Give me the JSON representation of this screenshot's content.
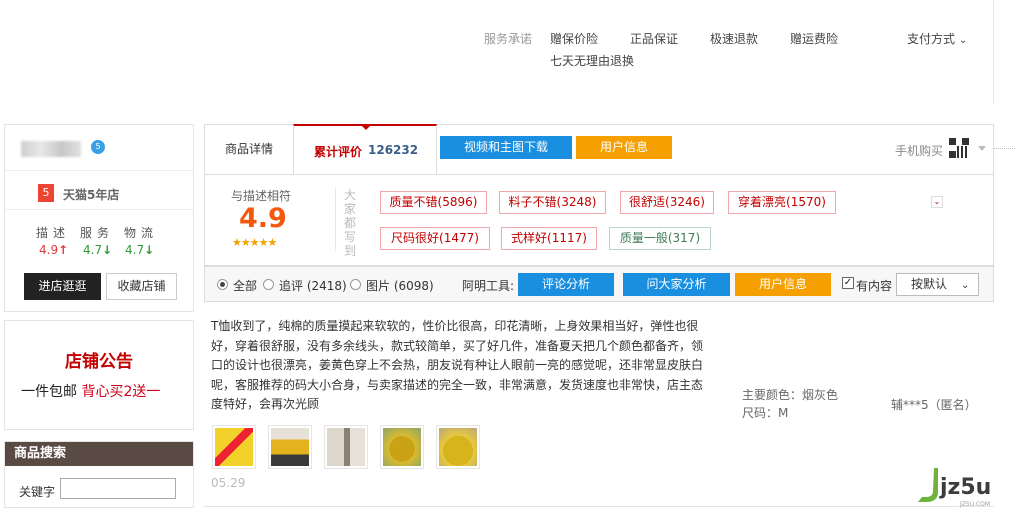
{
  "service_bar": {
    "label": "服务承诺",
    "items": [
      "赠保价险",
      "正品保证",
      "极速退款",
      "赠运费险"
    ],
    "second_line": "七天无理由退换",
    "payment": "支付方式"
  },
  "shop_card": {
    "badge": "5",
    "rank_number": "5",
    "rank_text": "天猫5年店",
    "headers": [
      "描述",
      "服务",
      "物流"
    ],
    "scores": [
      {
        "value": "4.9",
        "trend": "↑",
        "color": "#e4393c"
      },
      {
        "value": "4.7",
        "trend": "↓",
        "color": "#2e9c35"
      },
      {
        "value": "4.7",
        "trend": "↓",
        "color": "#2e9c35"
      }
    ],
    "enter_shop": "进店逛逛",
    "favorite_shop": "收藏店铺"
  },
  "notice": {
    "title": "店铺公告",
    "line_prefix": "一件包邮 ",
    "line_highlight": "背心买2送一"
  },
  "search": {
    "title": "商品搜索",
    "keyword_label": "关键字",
    "keyword_value": ""
  },
  "tabs": {
    "detail": "商品详情",
    "reviews_label": "累计评价",
    "reviews_count": "126232",
    "video_download": "视频和主图下载",
    "user_info": "用户信息",
    "mobile_buy": "手机购买"
  },
  "summary": {
    "label": "与描述相符",
    "score": "4.9",
    "stars": "★★★★★",
    "side_text": "大家都写到",
    "tags": [
      {
        "text": "质量不错(5896)",
        "type": "positive"
      },
      {
        "text": "料子不错(3248)",
        "type": "positive"
      },
      {
        "text": "很舒适(3246)",
        "type": "positive"
      },
      {
        "text": "穿着漂亮(1570)",
        "type": "positive"
      },
      {
        "text": "尺码很好(1477)",
        "type": "positive"
      },
      {
        "text": "式样好(1117)",
        "type": "positive"
      },
      {
        "text": "质量一般(317)",
        "type": "neutral"
      }
    ]
  },
  "filter": {
    "options": [
      {
        "label": "全部",
        "selected": true
      },
      {
        "label": "追评 (2418)",
        "selected": false
      },
      {
        "label": "图片 (6098)",
        "selected": false
      }
    ],
    "tools_label": "阿明工具:",
    "tool_buttons": [
      "评论分析",
      "问大家分析",
      "用户信息"
    ],
    "has_content": "有内容",
    "has_content_checked": true,
    "sort": "按默认"
  },
  "review": {
    "text": "T恤收到了，纯棉的质量摸起来软软的，性价比很高，印花清晰，上身效果相当好，弹性也很好，穿着很舒服，没有多余线头，款式较简单，买了好几件，准备夏天把几个颜色都备齐，领口的设计也很漂亮，姜黄色穿上不会热，朋友说有种让人眼前一亮的感觉呢，还非常显皮肤白呢，客服推荐的码大小合身，与卖家描述的完全一致，非常满意，发货速度也非常快，店主态度特好，会再次光顾",
    "date": "05.29",
    "meta_color": "主要颜色：烟灰色",
    "meta_size": "尺码：M",
    "user": "辅***5（匿名）",
    "thumb_colors": [
      "#e8c417",
      "#d9a820",
      "#d6cfc6",
      "#c9a318",
      "#d4b51c"
    ]
  },
  "watermark": {
    "text": "jz5u",
    "sub": "JZ5U.COM"
  }
}
